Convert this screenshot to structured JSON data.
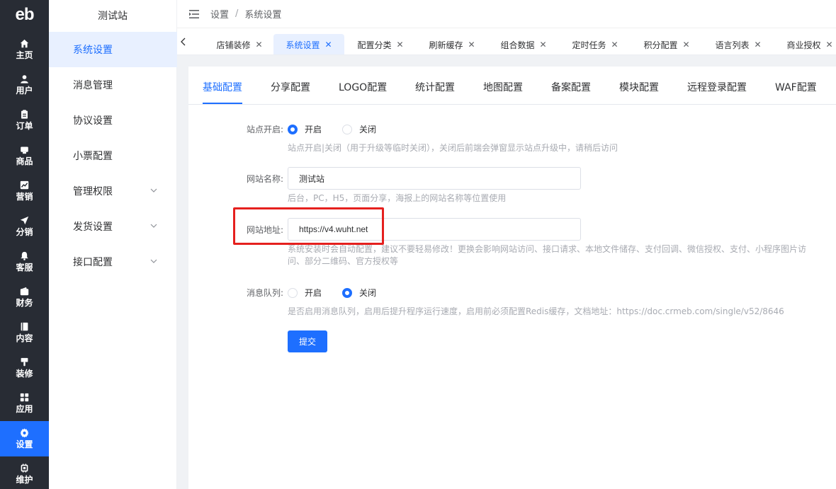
{
  "app": {
    "logo": "eb",
    "site_name": "测试站"
  },
  "rail": [
    {
      "label": "主页",
      "icon": "home-icon"
    },
    {
      "label": "用户",
      "icon": "user-icon"
    },
    {
      "label": "订单",
      "icon": "order-icon"
    },
    {
      "label": "商品",
      "icon": "product-icon"
    },
    {
      "label": "营销",
      "icon": "marketing-icon"
    },
    {
      "label": "分销",
      "icon": "distribution-icon"
    },
    {
      "label": "客服",
      "icon": "bell-icon"
    },
    {
      "label": "财务",
      "icon": "wallet-icon"
    },
    {
      "label": "内容",
      "icon": "book-icon"
    },
    {
      "label": "装修",
      "icon": "brush-icon"
    },
    {
      "label": "应用",
      "icon": "grid-icon"
    },
    {
      "label": "设置",
      "icon": "gear-icon",
      "active": true
    },
    {
      "label": "维护",
      "icon": "chip-icon"
    }
  ],
  "submenu": [
    {
      "label": "系统设置",
      "active": true
    },
    {
      "label": "消息管理"
    },
    {
      "label": "协议设置"
    },
    {
      "label": "小票配置"
    },
    {
      "label": "管理权限",
      "expandable": true
    },
    {
      "label": "发货设置",
      "expandable": true
    },
    {
      "label": "接口配置",
      "expandable": true
    }
  ],
  "breadcrumb": [
    "设置",
    "系统设置"
  ],
  "breadcrumb_sep": "/",
  "tabs": [
    {
      "label": "店铺装修"
    },
    {
      "label": "系统设置",
      "active": true
    },
    {
      "label": "配置分类"
    },
    {
      "label": "刷新缓存"
    },
    {
      "label": "组合数据"
    },
    {
      "label": "定时任务"
    },
    {
      "label": "积分配置"
    },
    {
      "label": "语言列表"
    },
    {
      "label": "商业授权"
    }
  ],
  "tab_close": "✕",
  "content_tabs": [
    "基础配置",
    "分享配置",
    "LOGO配置",
    "统计配置",
    "地图配置",
    "备案配置",
    "模块配置",
    "远程登录配置",
    "WAF配置"
  ],
  "form": {
    "site_open": {
      "label": "站点开启:",
      "options": [
        "开启",
        "关闭"
      ],
      "selected": "开启",
      "hint": "站点开启|关闭（用于升级等临时关闭），关闭后前端会弹窗显示站点升级中，请稍后访问"
    },
    "site_name": {
      "label": "网站名称:",
      "value": "测试站",
      "hint": "后台，PC，H5，页面分享，海报上的网站名称等位置使用"
    },
    "site_url": {
      "label": "网站地址:",
      "value": "https://v4.wuht.net",
      "hint": "系统安装时会自动配置，建议不要轻易修改！更换会影响网站访问、接口请求、本地文件储存、支付回调、微信授权、支付、小程序图片访问、部分二维码、官方授权等"
    },
    "message_queue": {
      "label": "消息队列:",
      "options": [
        "开启",
        "关闭"
      ],
      "selected": "关闭",
      "hint": "是否启用消息队列，启用后提升程序运行速度，启用前必须配置Redis缓存，文档地址：https://doc.crmeb.com/single/v52/8646"
    },
    "submit_label": "提交"
  },
  "colors": {
    "primary": "#1e6fff",
    "rail_bg": "#282c34",
    "highlight": "#e5201e"
  }
}
